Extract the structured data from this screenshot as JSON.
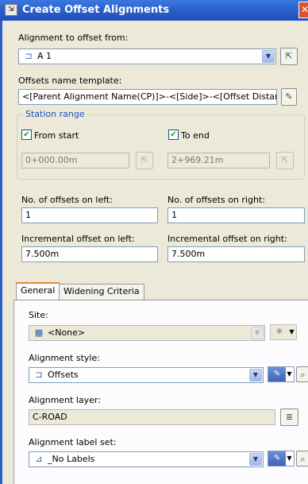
{
  "window": {
    "title": "Create Offset Alignments",
    "close_glyph": "✕"
  },
  "alignment_from": {
    "label": "Alignment to offset from:",
    "value": "A 1"
  },
  "name_template": {
    "label": "Offsets name template:",
    "value": "<[Parent Alignment Name(CP)]>-<[Side]>-<[Offset Distance]>"
  },
  "station_range": {
    "title": "Station range",
    "from_start": {
      "label": "From start",
      "checked": true,
      "value": "0+000.00m"
    },
    "to_end": {
      "label": "To end",
      "checked": true,
      "value": "2+969.21m"
    }
  },
  "offsets": {
    "left_count_label": "No. of offsets on left:",
    "left_count": "1",
    "right_count_label": "No. of offsets on right:",
    "right_count": "1",
    "left_inc_label": "Incremental offset on left:",
    "left_inc": "7.500m",
    "right_inc_label": "Incremental offset on right:",
    "right_inc": "7.500m"
  },
  "tabs": [
    {
      "label": "General"
    },
    {
      "label": "Widening Criteria"
    }
  ],
  "general": {
    "site_label": "Site:",
    "site_value": "<None>",
    "style_label": "Alignment style:",
    "style_value": "Offsets",
    "layer_label": "Alignment layer:",
    "layer_value": "C-ROAD",
    "label_set_label": "Alignment label set:",
    "label_set_value": "_No Labels"
  }
}
